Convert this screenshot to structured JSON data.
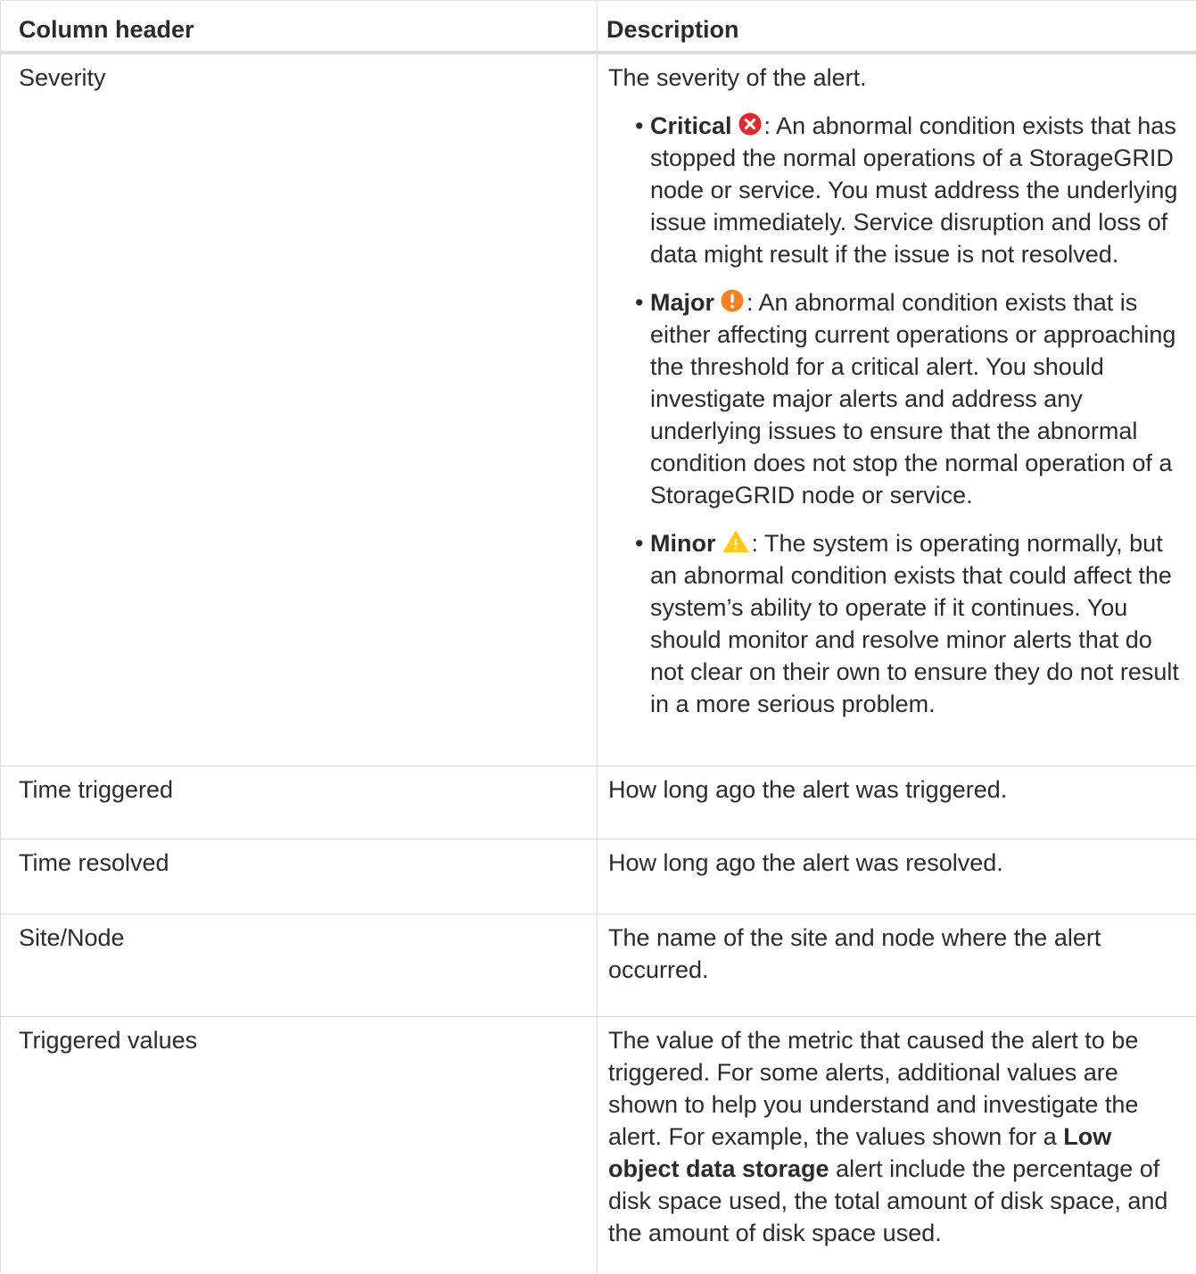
{
  "table": {
    "headers": {
      "column_header": "Column header",
      "description": "Description"
    },
    "rows": {
      "severity": {
        "name": "Severity",
        "intro": "The severity of the alert.",
        "levels": [
          {
            "label": "Critical",
            "icon": "critical-x-icon",
            "color": "#e0282e",
            "text": ": An abnormal condition exists that has stopped the normal operations of a StorageGRID node or service. You must address the underlying issue immediately. Service disruption and loss of data might result if the issue is not resolved."
          },
          {
            "label": "Major",
            "icon": "major-exclamation-icon",
            "color": "#f58220",
            "text": ": An abnormal condition exists that is either affecting current operations or approaching the threshold for a critical alert. You should investigate major alerts and address any underlying issues to ensure that the abnormal condition does not stop the normal operation of a StorageGRID node or service."
          },
          {
            "label": "Minor",
            "icon": "minor-warning-triangle-icon",
            "color": "#ffc91f",
            "text": ": The system is operating normally, but an abnormal condition exists that could affect the system’s ability to operate if it continues. You should monitor and resolve minor alerts that do not clear on their own to ensure they do not result in a more serious problem."
          }
        ]
      },
      "time_triggered": {
        "name": "Time triggered",
        "description": "How long ago the alert was triggered."
      },
      "time_resolved": {
        "name": "Time resolved",
        "description": "How long ago the alert was resolved."
      },
      "site_node": {
        "name": "Site/Node",
        "description": "The name of the site and node where the alert occurred."
      },
      "triggered_values": {
        "name": "Triggered values",
        "desc_before": "The value of the metric that caused the alert to be triggered. For some alerts, additional values are shown to help you understand and investigate the alert. For example, the values shown for a ",
        "desc_bold": "Low object data storage",
        "desc_after": " alert include the percentage of disk space used, the total amount of disk space, and the amount of disk space used."
      }
    }
  }
}
